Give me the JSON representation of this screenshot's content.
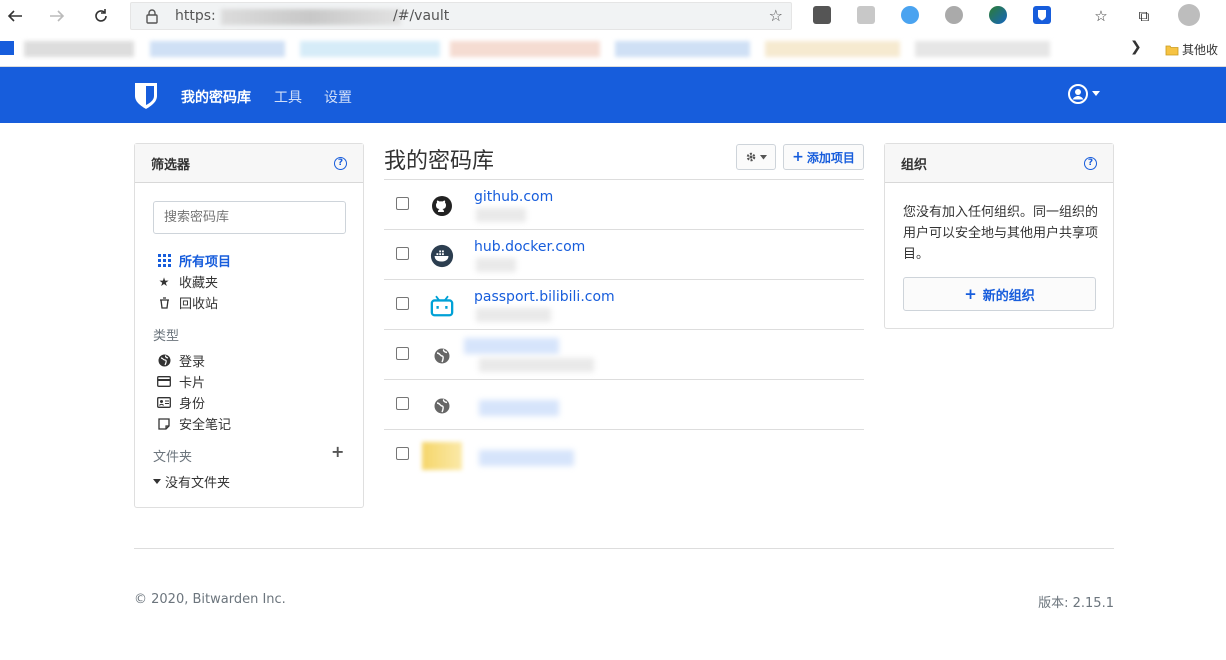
{
  "browser": {
    "url_prefix": "https:",
    "url_suffix": "/#/vault",
    "other_bookmarks": "其他收"
  },
  "nav": {
    "links": [
      "我的密码库",
      "工具",
      "设置"
    ]
  },
  "filters": {
    "header": "筛选器",
    "search_placeholder": "搜索密码库",
    "all_items": "所有项目",
    "favorites": "收藏夹",
    "trash": "回收站",
    "types_label": "类型",
    "types": [
      "登录",
      "卡片",
      "身份",
      "安全笔记"
    ],
    "folders_label": "文件夹",
    "no_folder": "没有文件夹"
  },
  "vault": {
    "title": "我的密码库",
    "add_item": "添加项目",
    "items": [
      {
        "name": "github.com",
        "icon": "github-icon"
      },
      {
        "name": "hub.docker.com",
        "icon": "docker-icon"
      },
      {
        "name": "passport.bilibili.com",
        "icon": "bilibili-icon"
      },
      {
        "name": "",
        "icon": "globe-icon"
      },
      {
        "name": "",
        "icon": "globe-icon"
      },
      {
        "name": "",
        "icon": "note-icon"
      }
    ]
  },
  "orgs": {
    "header": "组织",
    "text": "您没有加入任何组织。同一组织的用户可以安全地与其他用户共享项目。",
    "new_org": "新的组织"
  },
  "footer": {
    "copyright": "© 2020, Bitwarden Inc.",
    "version": "版本: 2.15.1"
  },
  "colors": {
    "brand": "#175ddc"
  }
}
